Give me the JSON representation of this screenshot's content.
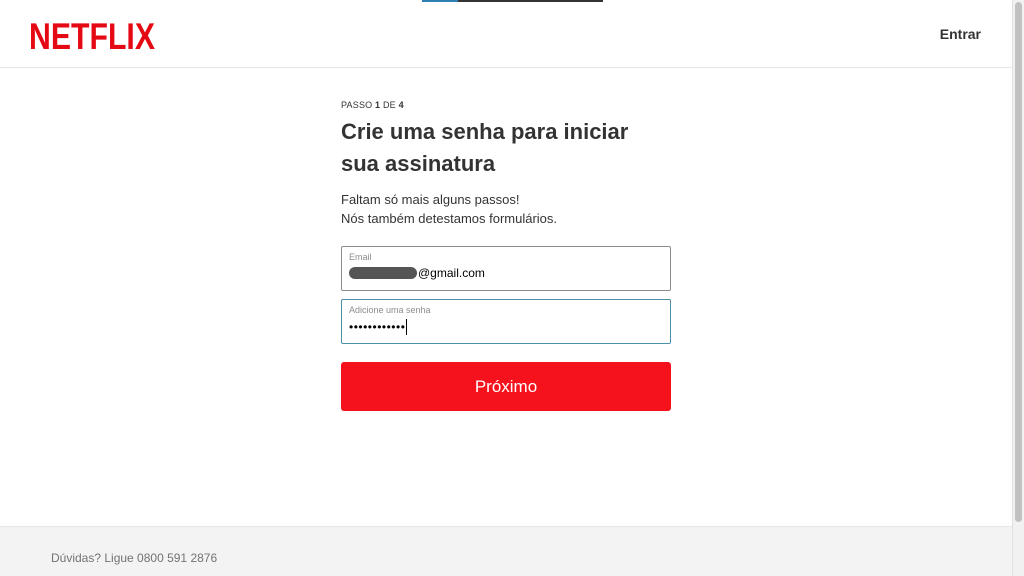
{
  "brand": {
    "logo_text": "NETFLIX",
    "color": "#e50914"
  },
  "header": {
    "signin_label": "Entrar"
  },
  "form": {
    "step_prefix": "PASSO ",
    "step_current": "1",
    "step_sep": " DE ",
    "step_total": "4",
    "title": "Crie uma senha para iniciar sua assinatura",
    "subtitle_line1": "Faltam só mais alguns passos!",
    "subtitle_line2": "Nós também detestamos formulários.",
    "email": {
      "label": "Email",
      "value_suffix": "@gmail.com"
    },
    "password": {
      "label": "Adicione uma senha",
      "value_masked": "••••••••••••"
    },
    "next_button_label": "Próximo",
    "button_color": "#f6121d"
  },
  "footer": {
    "phone_text": "Dúvidas? Ligue 0800 591 2876"
  }
}
